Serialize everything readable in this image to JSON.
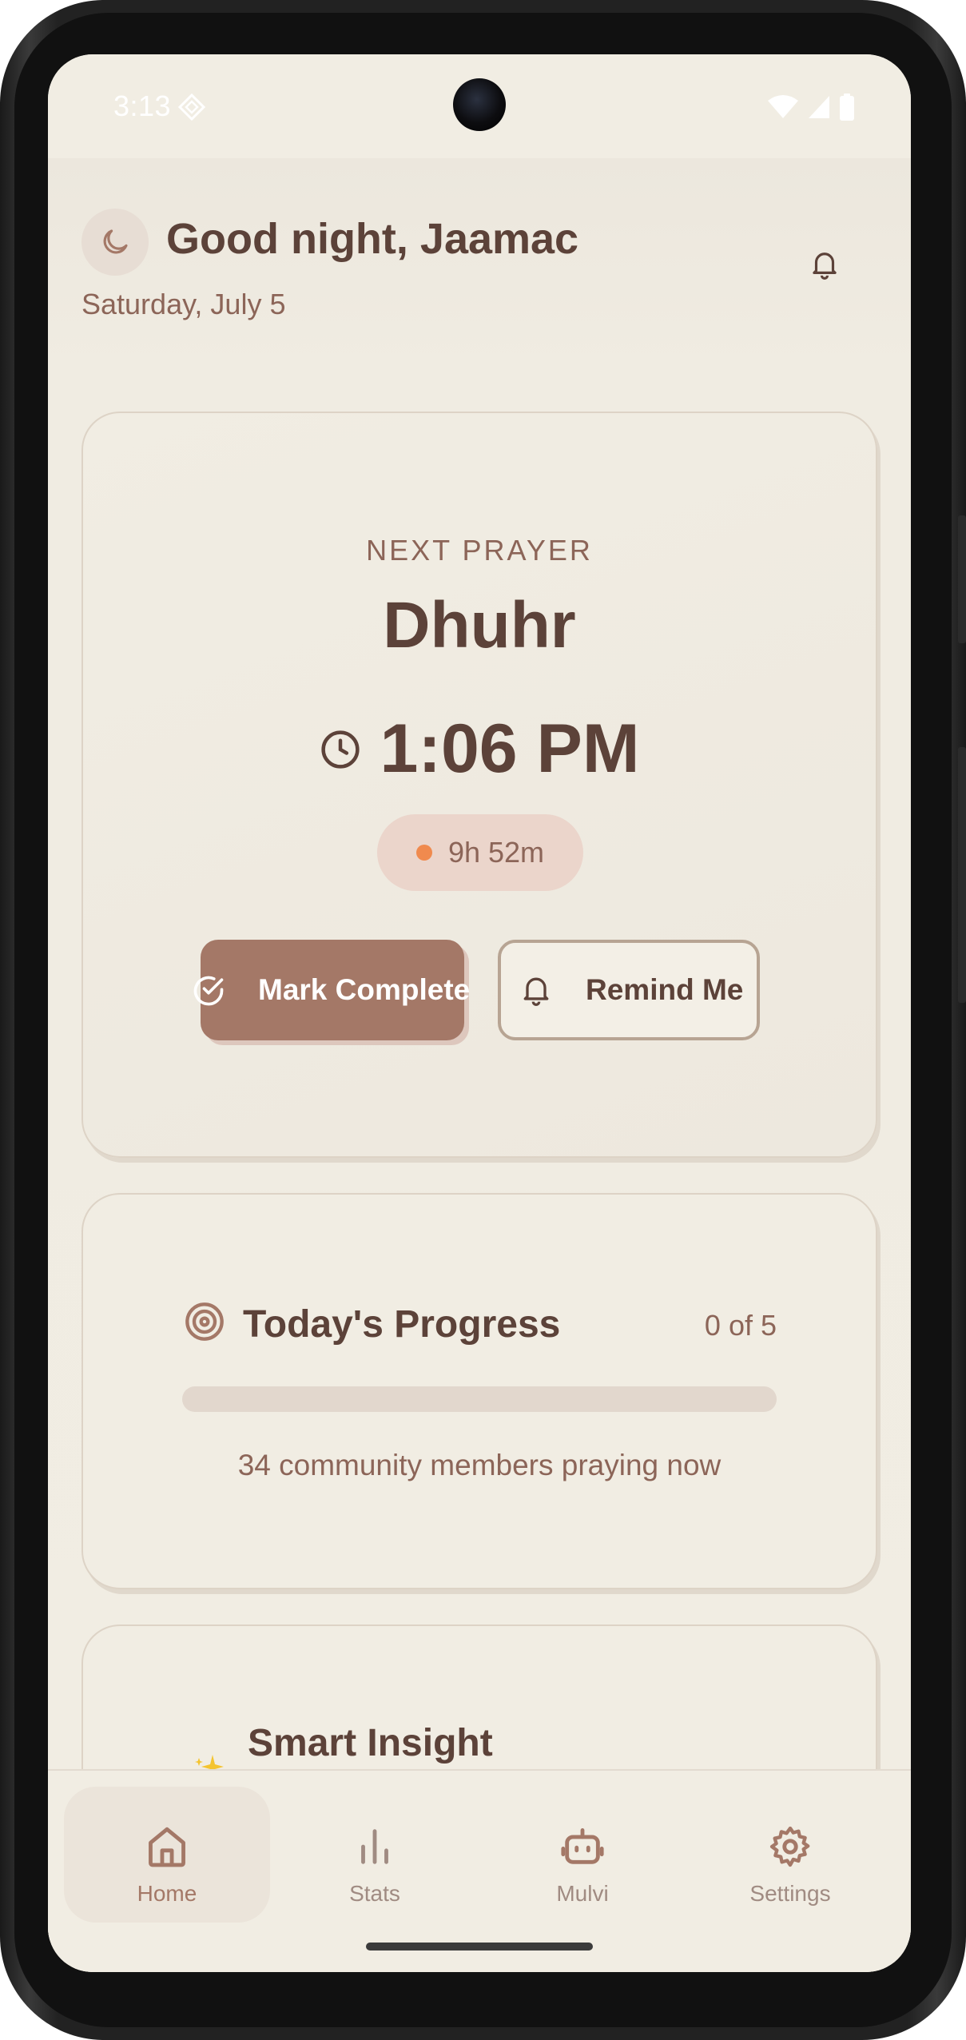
{
  "status_bar": {
    "time": "3:13"
  },
  "header": {
    "greeting": "Good night, Jaamac",
    "date": "Saturday, July 5"
  },
  "next_prayer": {
    "label": "NEXT PRAYER",
    "name": "Dhuhr",
    "time": "1:06 PM",
    "countdown": "9h 52m",
    "mark_complete_label": "Mark Complete",
    "remind_label": "Remind Me"
  },
  "progress": {
    "title": "Today's Progress",
    "count": "0 of 5",
    "fraction": 0,
    "community_text": "34 community members praying now"
  },
  "insight": {
    "title": "Smart Insight"
  },
  "nav": {
    "items": [
      {
        "label": "Home",
        "icon": "home-icon",
        "active": true
      },
      {
        "label": "Stats",
        "icon": "bar-chart-icon",
        "active": false
      },
      {
        "label": "Mulvi",
        "icon": "robot-icon",
        "active": false
      },
      {
        "label": "Settings",
        "icon": "gear-icon",
        "active": false
      }
    ]
  },
  "colors": {
    "background": "#f1ede3",
    "primary_text": "#5c4239",
    "secondary_text": "#8c6558",
    "accent": "#a47867",
    "countdown_dot": "#f08a4e"
  }
}
